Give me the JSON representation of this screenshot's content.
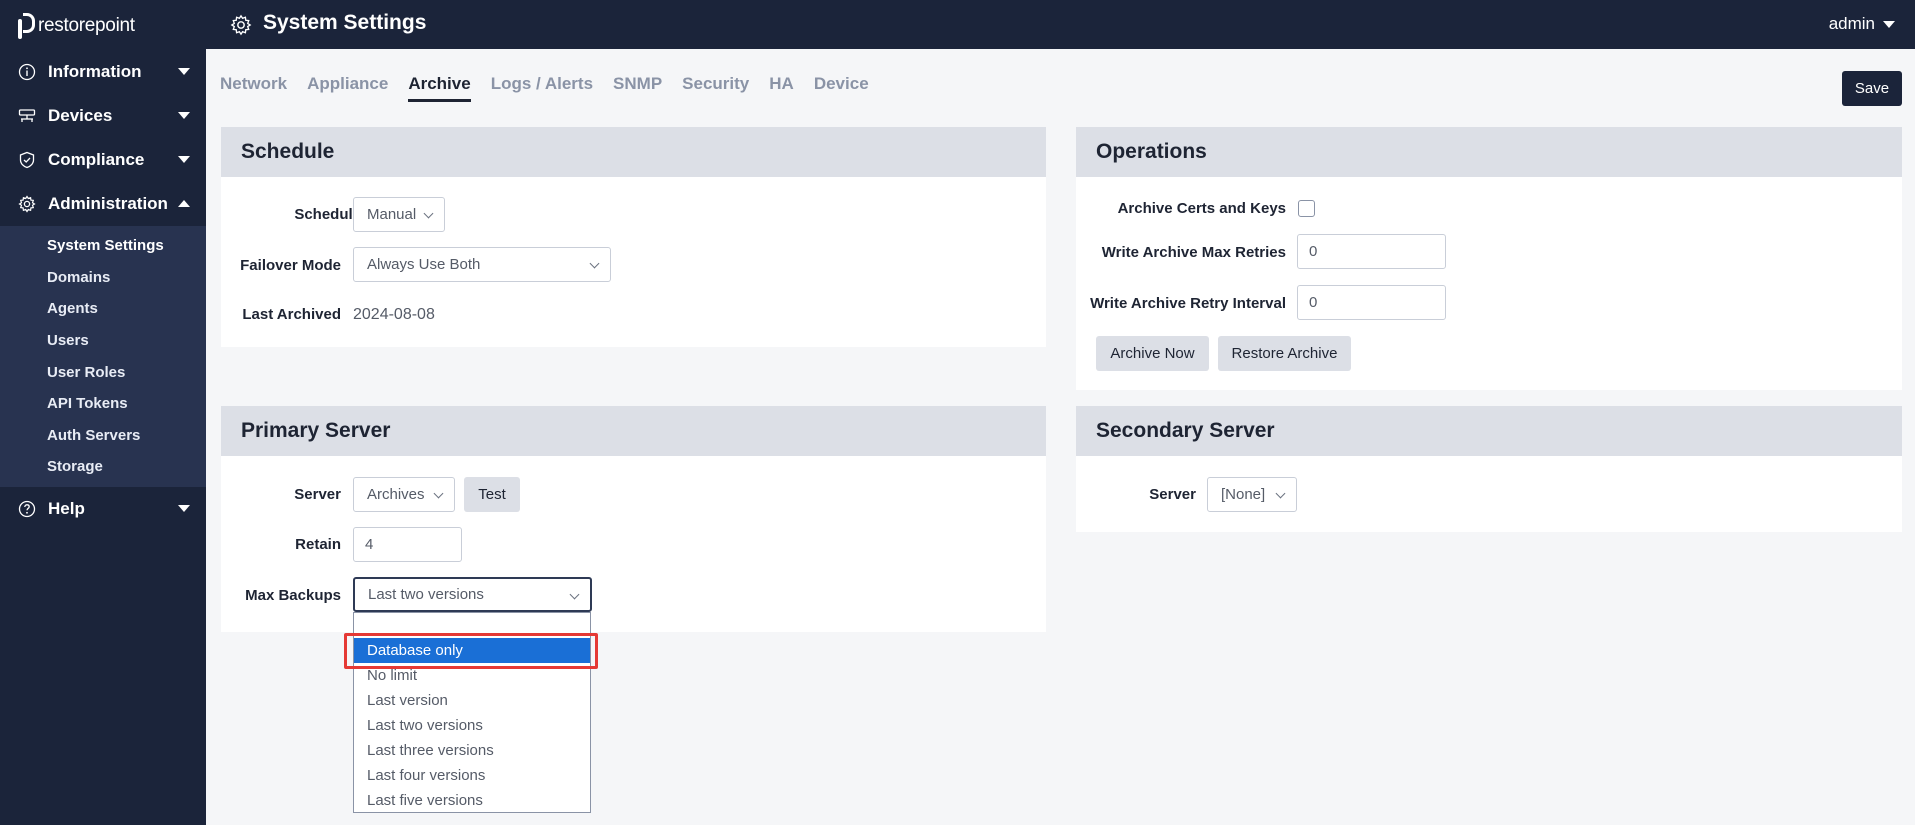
{
  "app": {
    "logo_text": "restorepoint"
  },
  "topbar": {
    "title": "System Settings",
    "user": "admin"
  },
  "sidebar": {
    "items": [
      {
        "label": "Information"
      },
      {
        "label": "Devices"
      },
      {
        "label": "Compliance"
      },
      {
        "label": "Administration"
      },
      {
        "label": "Help"
      }
    ],
    "admin_sub": [
      "System Settings",
      "Domains",
      "Agents",
      "Users",
      "User Roles",
      "API Tokens",
      "Auth Servers",
      "Storage"
    ]
  },
  "tabs": [
    "Network",
    "Appliance",
    "Archive",
    "Logs / Alerts",
    "SNMP",
    "Security",
    "HA",
    "Device"
  ],
  "active_tab": "Archive",
  "toolbar": {
    "save_label": "Save"
  },
  "schedule": {
    "header": "Schedule",
    "schedule_label": "Schedule",
    "schedule_value": "Manual",
    "failover_label": "Failover Mode",
    "failover_value": "Always Use Both",
    "last_archived_label": "Last Archived",
    "last_archived_value": "2024-08-08"
  },
  "operations": {
    "header": "Operations",
    "certs_label": "Archive Certs and Keys",
    "max_retries_label": "Write Archive Max Retries",
    "max_retries_value": "0",
    "retry_interval_label": "Write Archive Retry Interval",
    "retry_interval_value": "0",
    "archive_now": "Archive Now",
    "restore_archive": "Restore Archive"
  },
  "primary": {
    "header": "Primary Server",
    "server_label": "Server",
    "server_value": "Archives",
    "test_label": "Test",
    "retain_label": "Retain",
    "retain_value": "4",
    "max_backups_label": "Max Backups",
    "max_backups_value": "Last two versions",
    "options": [
      "Database only",
      "No limit",
      "Last version",
      "Last two versions",
      "Last three versions",
      "Last four versions",
      "Last five versions"
    ],
    "highlighted_option": "Database only"
  },
  "secondary": {
    "header": "Secondary Server",
    "server_label": "Server",
    "server_value": "[None]"
  },
  "colors": {
    "sidebar_bg": "#1b243a",
    "highlight": "#e53935",
    "selected_option": "#1a6fd6"
  }
}
